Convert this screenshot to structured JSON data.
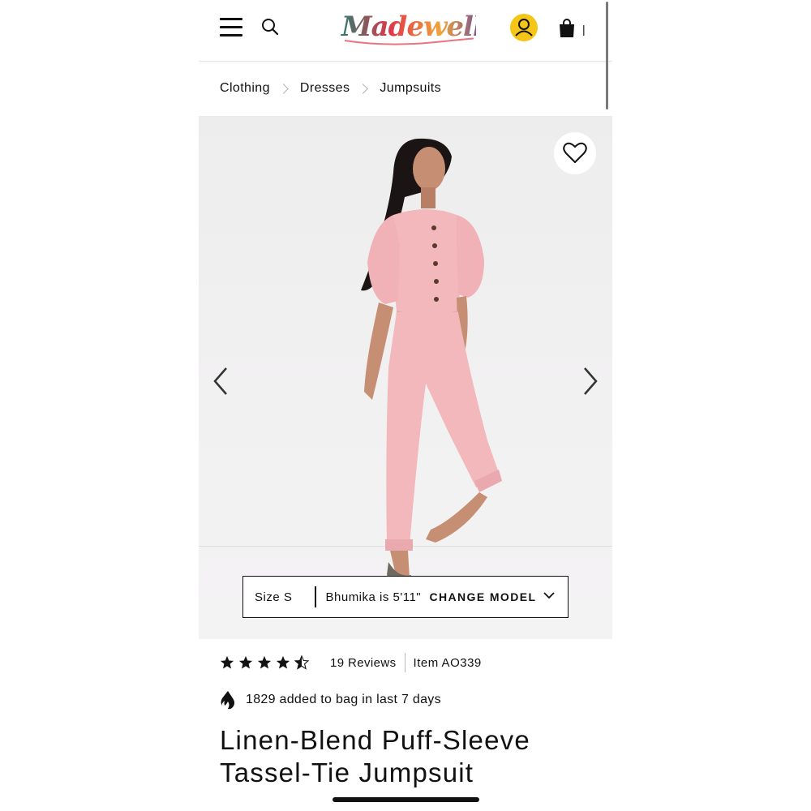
{
  "header": {
    "logo_text": "Madewell",
    "bag_count": "|"
  },
  "breadcrumb": [
    "Clothing",
    "Dresses",
    "Jumpsuits"
  ],
  "hero": {
    "size_label": "Size S",
    "model_height": "Bhumika is 5'11\"",
    "change_model_label": "CHANGE MODEL"
  },
  "product": {
    "rating": 4.5,
    "reviews_label": "19 Reviews",
    "item_number": "Item AO339",
    "popularity_text": "1829 added to bag in last 7 days",
    "title_line1": "Linen-Blend Puff-Sleeve",
    "title_line2": "Tassel-Tie Jumpsuit"
  },
  "icons": {
    "menu": "hamburger-menu-icon",
    "search": "magnifier-icon",
    "account": "person-icon",
    "bag": "shopping-bag-icon",
    "favorite": "heart-outline-icon",
    "prev": "chevron-left-icon",
    "next": "chevron-right-icon",
    "dropdown": "chevron-down-icon",
    "popularity": "flame-icon"
  },
  "colors": {
    "account_badge": "#f5c518",
    "jumpsuit": "#f2b8bb",
    "logo_colors": [
      "#2f7a6f",
      "#e0394a",
      "#f2a33a",
      "#6a4c9c"
    ]
  }
}
